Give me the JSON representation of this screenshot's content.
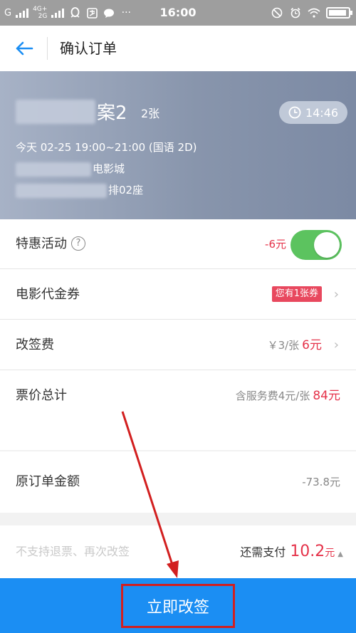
{
  "status_bar": {
    "carrier_left": "G",
    "network_top": "4G+",
    "network_bottom": "2G",
    "icons": [
      "signal-icon",
      "qq-icon",
      "alipay-icon",
      "message-icon",
      "more-icon",
      "mute-icon",
      "alarm-icon",
      "wifi-icon",
      "battery-icon"
    ],
    "more": "···",
    "time": "16:00"
  },
  "header": {
    "title": "确认订单"
  },
  "movie": {
    "title_suffix": "案2",
    "ticket_count": "2张",
    "countdown": "14:46",
    "showtime": "今天 02-25 19:00~21:00 (国语 2D)",
    "cinema_suffix": "电影城",
    "seat_suffix": "排02座"
  },
  "rows": {
    "promo": {
      "label": "特惠活动",
      "help": "?",
      "discount": "-6元",
      "enabled": true
    },
    "voucher": {
      "label": "电影代金券",
      "badge": "您有1张券"
    },
    "change_fee": {
      "label": "改签费",
      "unit_price": "￥3/张",
      "amount": "6元"
    },
    "ticket_total": {
      "label": "票价总计",
      "note": "含服务费4元/张",
      "amount": "84元"
    },
    "original": {
      "label": "原订单金额",
      "amount": "-73.8元"
    }
  },
  "payment": {
    "hint": "不支持退票、再次改签",
    "label": "还需支付",
    "amount": "10.2",
    "unit": "元",
    "toggle_symbol": "▲"
  },
  "action": {
    "label": "立即改签"
  },
  "colors": {
    "primary": "#1b8ef3",
    "price_red": "#e5334a",
    "toggle_green": "#5cc35f",
    "annotation_red": "#d21f1f"
  }
}
